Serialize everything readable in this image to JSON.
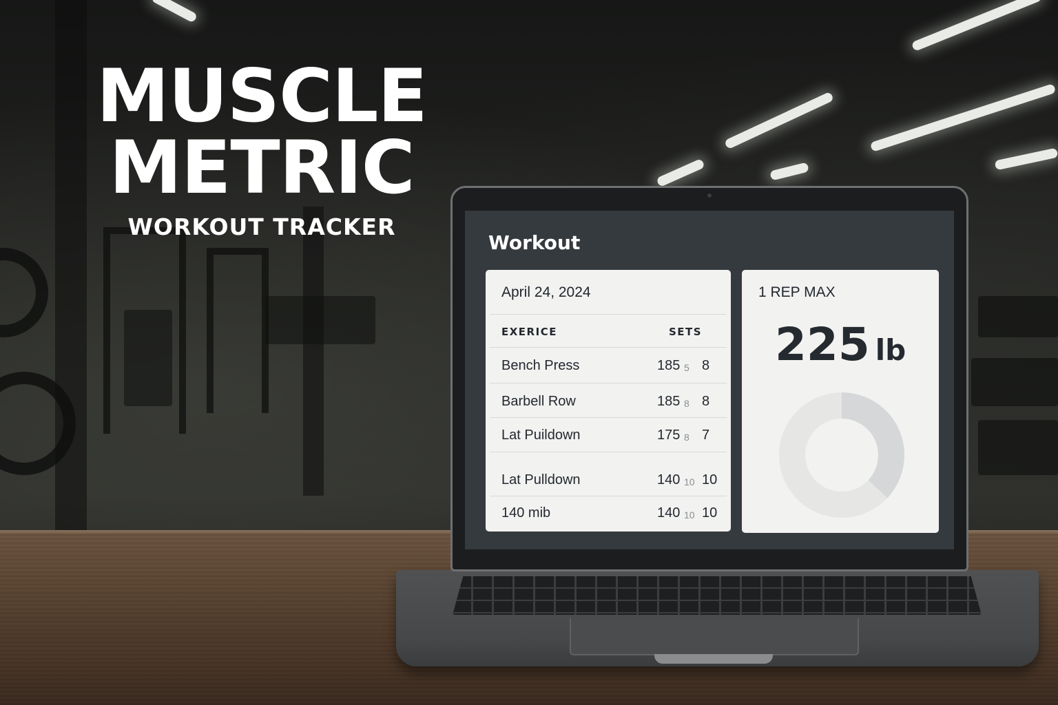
{
  "brand": {
    "title_line1": "MUSCLE",
    "title_line2": "METRIC",
    "subtitle": "WORKOUT TRACKER"
  },
  "app": {
    "title": "Workout",
    "workout_card": {
      "date": "April 24, 2024",
      "columns": {
        "exercise": "EXERICE",
        "sets": "SETS"
      },
      "rows": [
        {
          "exercise": "Bench Press",
          "weight": "185",
          "sets": "5",
          "reps": "8"
        },
        {
          "exercise": "Barbell Row",
          "weight": "185",
          "sets": "8",
          "reps": "8"
        },
        {
          "exercise": "Lat Puildown",
          "weight": "175",
          "sets": "8",
          "reps": "7"
        },
        {
          "exercise": "Lat Pulldown",
          "weight": "140",
          "sets": "10",
          "reps": "10"
        },
        {
          "exercise": "140 mib",
          "weight": "140",
          "sets": "10",
          "reps": "10"
        }
      ]
    },
    "max_card": {
      "label": "1 REP MAX",
      "value": "225",
      "unit": "lb",
      "donut": {
        "fraction": 0.37,
        "colors": {
          "filled": "#d6d7d8",
          "track": "#e6e6e5"
        }
      }
    }
  }
}
